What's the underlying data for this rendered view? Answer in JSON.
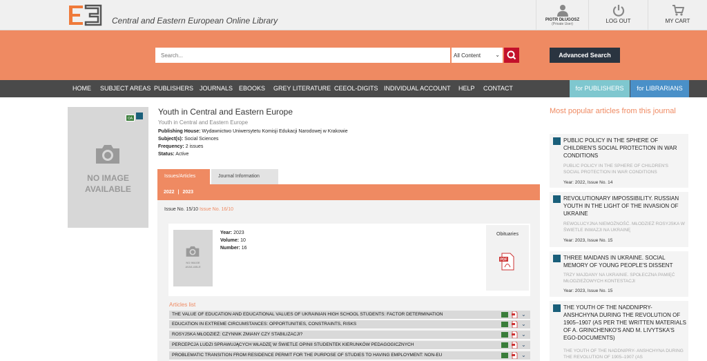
{
  "header": {
    "site_title": "Central and Eastern European Online Library",
    "user": {
      "name": "PIOTR DŁUGOSZ",
      "role": "(Private User)"
    },
    "logout_label": "LOG OUT",
    "cart_label": "MY CART"
  },
  "search": {
    "placeholder": "Search...",
    "content_select": "All Content",
    "advanced_label": "Advanced Search"
  },
  "nav": {
    "items": [
      "HOME",
      "SUBJECT AREAS",
      "PUBLISHERS",
      "JOURNALS",
      "EBOOKS",
      "GREY LITERATURE",
      "CEEOL-DIGITS",
      "INDIVIDUAL ACCOUNT",
      "HELP",
      "CONTACT"
    ],
    "publishers_pill": "for PUBLISHERS",
    "librarians_pill": "for LIBRARIANS",
    "publishers_color": "#7fc7cf",
    "librarians_color": "#4a90c8"
  },
  "journal": {
    "no_image_line1": "NO IMAGE",
    "no_image_line2": "AVAILABLE",
    "oa_badge": "OA",
    "title": "Youth in Central and Eastern Europe",
    "subtitle": "Youth in Central and Eastern Europe",
    "publishing_house_label": "Publishing House:",
    "publishing_house": "Wydawnictwo Uniwersytetu Komisji Edukacji Narodowej w Krakowie",
    "subjects_label": "Subject(s):",
    "subjects": "Social Sciences",
    "frequency_label": "Frequency:",
    "frequency": "2 issues",
    "status_label": "Status:",
    "status": "Active"
  },
  "tabs": {
    "issues": "Issues/Articles",
    "info": "Journal Information"
  },
  "years": {
    "y1": "2022",
    "sep": "|",
    "y2": "2023"
  },
  "issues": {
    "first": "Issue No. 15/10",
    "second": "Issue No. 16/10"
  },
  "issue": {
    "no_image_line1": "NO IMAGE",
    "no_image_line2": "AVAILABLE",
    "year_label": "Year:",
    "year": "2023",
    "volume_label": "Volume:",
    "volume": "10",
    "number_label": "Number:",
    "number": "16",
    "obituaries": "Obituaries"
  },
  "articles": {
    "title": "Articles list",
    "items": [
      "THE VALUE OF EDUCATION AND EDUCATIONAL VALUES OF UKRAINIAN HIGH SCHOOL STUDENTS: FACTOR DETERMINATION",
      "EDUCATION IN EXTREME CIRCUMSTANCES: OPPORTUNITIES, CONSTRAINTS, RISKS",
      "ROSYJSKA MŁODZIEŻ: CZYNNIK ZMIANY CZY STABILIZACJI?",
      "PERCEPCJA LUDZI SPRAWUJĄCYCH WŁADZĘ W ŚWIETLE OPINII STUDENTEK KIERUNKÓW PEDAGOGICZNYCH",
      "PROBLEMATIC TRANSITION FROM RESIDENCE PERMIT FOR THE PURPOSE OF STUDIES TO HAVING EMPLOYMENT: NON-EU"
    ]
  },
  "popular": {
    "heading": "Most popular articles from this journal",
    "items": [
      {
        "title": "PUBLIC POLICY IN THE SPHERE OF CHILDREN'S SOCIAL PROTECTION IN WAR CONDITIONS",
        "alt": "PUBLIC POLICY IN THE SPHERE OF CHILDREN'S SOCIAL PROTECTION IN WAR CONDITIONS",
        "year": "Year: 2022, Issue No. 14"
      },
      {
        "title": "REVOLUTIONARY IMPOSSIBILITY. RUSSIAN YOUTH IN THE LIGHT OF THE INVASION OF UKRAINE",
        "alt": "REWOLUCYJNA NIEMOŻNOŚĆ. MŁODZIEŻ ROSYJSKA W ŚWIETLE INWAZJI NA UKRAINĘ",
        "year": "Year: 2023, Issue No. 15"
      },
      {
        "title": "THREE MAIDANS IN UKRAINE. SOCIAL MEMORY OF YOUNG PEOPLE'S DISSENT",
        "alt": "TRZY MAJDANY NA UKRAINIE. SPOŁECZNA PAMIĘĆ MŁODZIEŻOWYCH KONTESTACJI",
        "year": "Year: 2023, Issue No. 15"
      },
      {
        "title": "THE YOUTH OF THE NADDNIPRY-ANSHCHYNA DURING THE REVOLUTION OF 1905–1907 (AS PER THE WRITTEN MATERIALS OF A. GRINCHENKO'S AND M. LIVYTSKA'S EGO-DOCUMENTS)",
        "alt": "THE YOUTH OF THE NADDNIPRY- ANSHCHYNA DURING THE REVOLUTION OF 1905–1907 (AS",
        "year": ""
      }
    ]
  },
  "colors": {
    "accent": "#ef8a62",
    "nav": "#4a4a4a",
    "search_button": "#c3112b",
    "advanced": "#2a3440"
  }
}
